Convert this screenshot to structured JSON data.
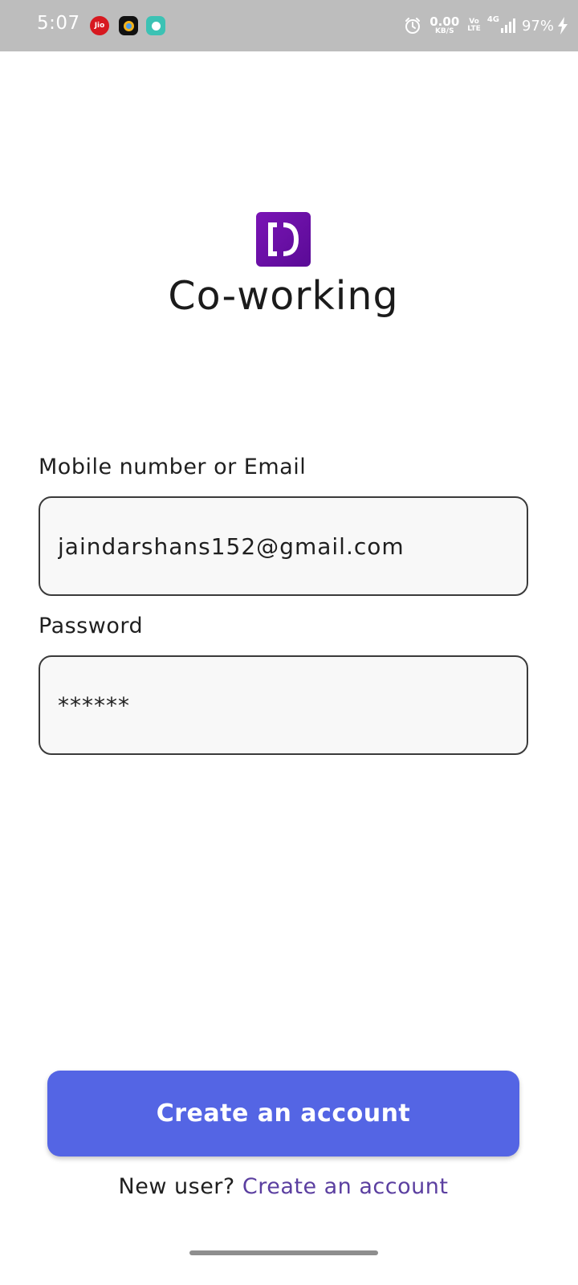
{
  "status_bar": {
    "time": "5:07",
    "apps": [
      "jio-icon",
      "ring-app-icon",
      "chat-app-icon"
    ],
    "jio_label": "Jio",
    "icons": [
      "alarm-icon",
      "signal-icon",
      "charging-icon"
    ],
    "net_speed_value": "0.00",
    "net_speed_unit": "KB/S",
    "volte_top": "Vo",
    "volte_bottom": "LTE",
    "network_type": "4G",
    "battery": "97%"
  },
  "brand": {
    "logo_icon": "bracket-d-logo",
    "app_name": "Co-working",
    "logo_color": "#6a0fa6"
  },
  "form": {
    "login_label": "Mobile number or Email",
    "login_value": "jaindarshans152@gmail.com",
    "password_label": "Password",
    "password_value": "******"
  },
  "actions": {
    "primary_button_label": "Create an account",
    "signup_prompt": "New user?",
    "signup_link": "Create an account"
  },
  "colors": {
    "button": "#5465e4",
    "link": "#5b3fa0",
    "field_bg": "#f8f8f8"
  }
}
